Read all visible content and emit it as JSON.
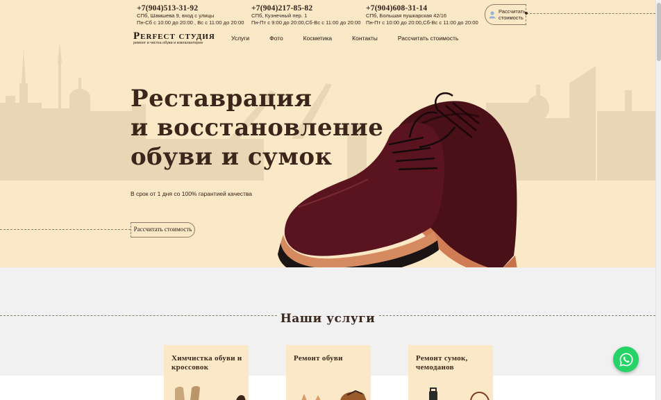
{
  "header": {
    "contacts": [
      {
        "phone": "+7(904)513-31-92",
        "address": "СПб, Шамшева 9, вход с улицы",
        "hours": "Пн-Сб с 10:00 до 20:00 , Вс с 11:00 до 20:00"
      },
      {
        "phone": "+7(904)217-85-82",
        "address": "СПб, Кузнечный пер. 1",
        "hours": "Пн-Пт с 9:00 до 20:00,Сб-Вс с 11:00 до 20:00"
      },
      {
        "phone": "+7(904)608-31-14",
        "address": "СПб, Большая пушкарская 42/16",
        "hours": "Пн-Пт с 10:00 до 20:00,Сб-Вс с 11:00 до 20:00"
      }
    ],
    "calc_button": "Рассчитать стоимость",
    "logo": {
      "name": "Perfect студия",
      "tagline": "ремонт и чистка обуви и кожгалантереи"
    },
    "nav": [
      "Услуги",
      "Фото",
      "Косметика",
      "Контакты",
      "Рассчитать стоимость"
    ]
  },
  "hero": {
    "title_lines": [
      "Реставрация",
      "и восстановление",
      "обуви и сумок"
    ],
    "subtitle": "В срок от 1 дня со 100% гарантией качества",
    "cta": "Рассчитать стоимость"
  },
  "services": {
    "title": "Наши услуги",
    "cards": [
      {
        "title": "Химчистка обуви и кроссовок",
        "icon": "boots-image"
      },
      {
        "title": "Ремонт обуви",
        "icon": "shoe-repair-image"
      },
      {
        "title": "Ремонт сумок, чемоданов",
        "icon": "bag-image"
      }
    ]
  },
  "colors": {
    "hero_bg": "#fbe8c6",
    "text": "#3a261b",
    "services_bg": "#f1f1f1",
    "whatsapp": "#25d366"
  },
  "icons": {
    "whatsapp": "whatsapp-icon",
    "user": "user-icon"
  }
}
